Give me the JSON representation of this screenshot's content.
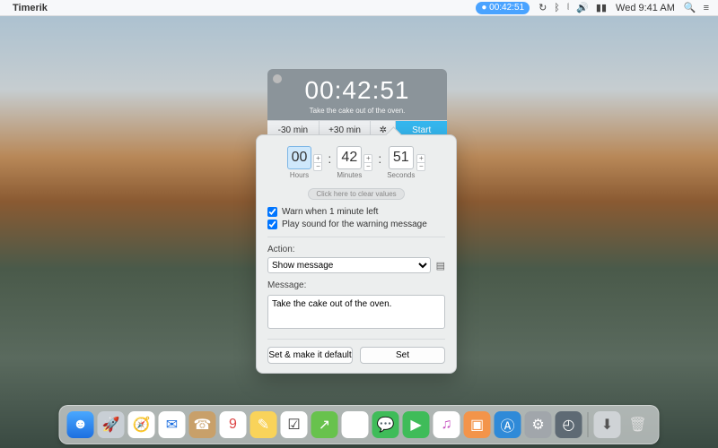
{
  "menubar": {
    "app_name": "Timerik",
    "pill_time": "00:42:51",
    "clock": "Wed 9:41 AM"
  },
  "timer": {
    "display": "00:42:51",
    "subtitle": "Take the cake out of the oven.",
    "minus_label": "-30 min",
    "plus_label": "+30 min",
    "start_label": "Start"
  },
  "settings": {
    "hours": {
      "value": "00",
      "label": "Hours"
    },
    "minutes": {
      "value": "42",
      "label": "Minutes"
    },
    "seconds": {
      "value": "51",
      "label": "Seconds"
    },
    "clear_label": "Click here to clear values",
    "warn_label": "Warn when 1 minute left",
    "sound_label": "Play sound for the warning message",
    "action_heading": "Action:",
    "action_selected": "Show message",
    "message_heading": "Message:",
    "message_value": "Take the cake out of the oven.",
    "set_default_label": "Set & make it default",
    "set_label": "Set"
  },
  "dock": {
    "colors": [
      "#c9cfd5",
      "#4a90e2",
      "#4a90e2",
      "#febd45",
      "#8e8e93",
      "#d55a4a",
      "#d44a3a",
      "#f9d35a",
      "#68c24d",
      "#3fbc59",
      "#3fbc59",
      "#2f8ad8",
      "#6fa8dc",
      "#6b4fa0",
      "#2f8ad8",
      "#a1a6ab",
      "#5e6a74",
      "#cfd3d6",
      "#3f4c57"
    ]
  }
}
